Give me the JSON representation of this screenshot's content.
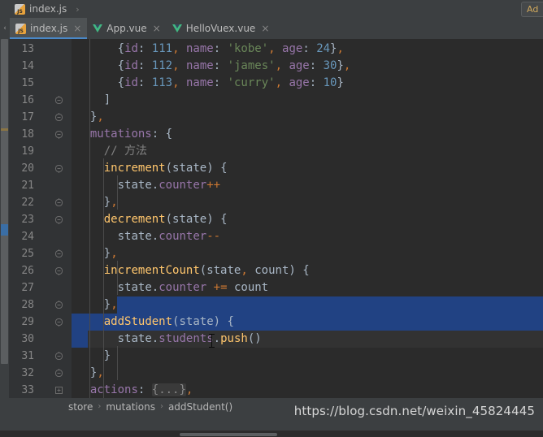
{
  "navbar": {
    "file_label": "index.js",
    "separator": "›",
    "add_configuration_label": "Ad"
  },
  "tabs": {
    "scroll_arrow": "‹",
    "items": [
      {
        "label": "index.js",
        "icon": "js-file-icon",
        "active": true,
        "close": "×"
      },
      {
        "label": "App.vue",
        "icon": "vue-file-icon",
        "active": false,
        "close": "×"
      },
      {
        "label": "HelloVuex.vue",
        "icon": "vue-file-icon",
        "active": false,
        "close": "×"
      }
    ]
  },
  "editor": {
    "first_line": 13,
    "last_line": 33,
    "line_numbers": [
      13,
      14,
      15,
      16,
      17,
      18,
      19,
      20,
      21,
      22,
      23,
      24,
      25,
      26,
      27,
      28,
      29,
      30,
      31,
      32,
      33
    ],
    "colors": {
      "background": "#2b2b2b",
      "gutter": "#313335",
      "selection": "#214283",
      "current_line": "#323232",
      "keyword": "#cc7832",
      "function": "#ffc66d",
      "property": "#9876aa",
      "number": "#6897bb",
      "string": "#6a8759",
      "comment": "#808080",
      "default_text": "#a9b7c6",
      "accent": "#4a88c7"
    },
    "lines": [
      {
        "n": 13,
        "text": "      {id: 111, name: 'kobe', age: 24},",
        "fold": null,
        "sel": "none"
      },
      {
        "n": 14,
        "text": "      {id: 112, name: 'james', age: 30},",
        "fold": null,
        "sel": "none"
      },
      {
        "n": 15,
        "text": "      {id: 113, name: 'curry', age: 10}",
        "fold": null,
        "sel": "none"
      },
      {
        "n": 16,
        "text": "    ]",
        "fold": "collapse-end",
        "sel": "none"
      },
      {
        "n": 17,
        "text": "  },",
        "fold": "collapse-end",
        "sel": "none"
      },
      {
        "n": 18,
        "text": "  mutations: {",
        "fold": "collapse-start",
        "sel": "none"
      },
      {
        "n": 19,
        "text": "    // 方法",
        "fold": null,
        "sel": "none"
      },
      {
        "n": 20,
        "text": "    increment(state) {",
        "fold": "collapse-start",
        "sel": "none"
      },
      {
        "n": 21,
        "text": "      state.counter++",
        "fold": null,
        "sel": "none"
      },
      {
        "n": 22,
        "text": "    },",
        "fold": "collapse-end",
        "sel": "none"
      },
      {
        "n": 23,
        "text": "    decrement(state) {",
        "fold": "collapse-start",
        "sel": "none"
      },
      {
        "n": 24,
        "text": "      state.counter--",
        "fold": null,
        "sel": "none"
      },
      {
        "n": 25,
        "text": "    },",
        "fold": "collapse-end",
        "sel": "none"
      },
      {
        "n": 26,
        "text": "    incrementCount(state, count) {",
        "fold": "collapse-start",
        "sel": "none"
      },
      {
        "n": 27,
        "text": "      state.counter += count",
        "fold": null,
        "sel": "none"
      },
      {
        "n": 28,
        "text": "    },",
        "fold": "collapse-end",
        "sel": "trailing"
      },
      {
        "n": 29,
        "text": "    addStudent(state) {",
        "fold": "collapse-start",
        "sel": "full"
      },
      {
        "n": 30,
        "text": "      state.students.push()",
        "fold": null,
        "sel": "leading"
      },
      {
        "n": 31,
        "text": "    }",
        "fold": "collapse-end",
        "sel": "none"
      },
      {
        "n": 32,
        "text": "  },",
        "fold": "collapse-end",
        "sel": "none"
      },
      {
        "n": 33,
        "text": "  actions: {...},",
        "fold": "expand",
        "sel": "none"
      }
    ]
  },
  "statusbar": {
    "crumbs": [
      "store",
      "mutations",
      "addStudent()"
    ],
    "separator": "›"
  },
  "watermark": {
    "text": "https://blog.csdn.net/weixin_45824445"
  }
}
